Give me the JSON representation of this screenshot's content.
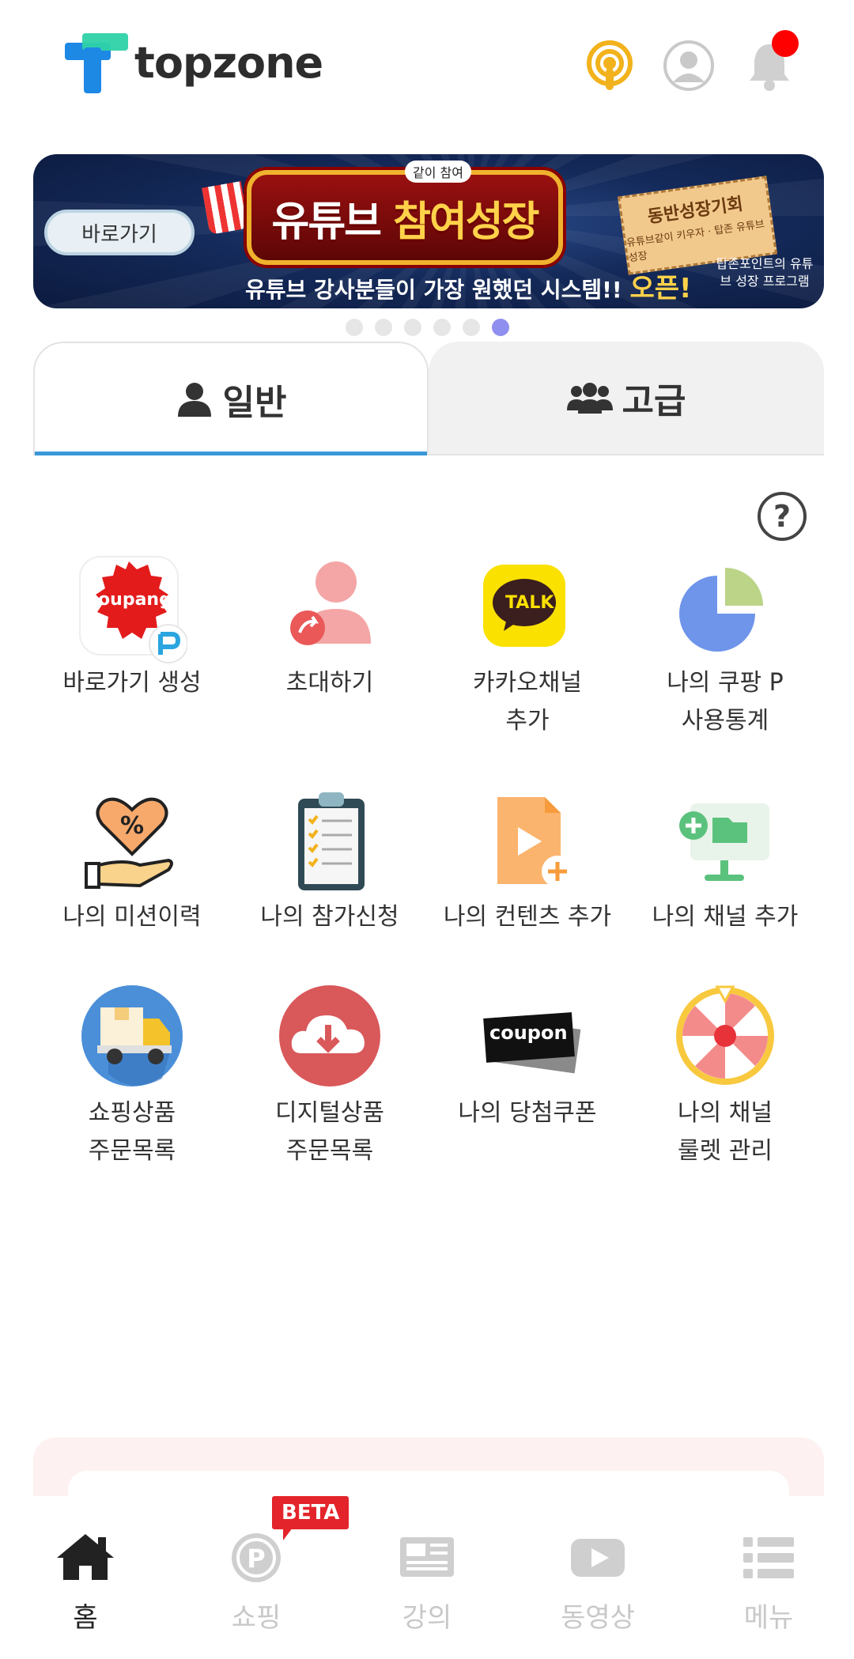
{
  "header": {
    "logo_text": "topzone"
  },
  "banner": {
    "button_label": "바로가기",
    "tag": "같이 참여",
    "title_a": "유튜브",
    "title_b": "참여성장",
    "subtitle": "유튜브 강사분들이 가장 원했던 시스템!!",
    "subtitle_hl": "오픈!",
    "ticket_title": "동반성장기회",
    "ticket_sub": "유튜브같이 키우자 · 탑존 유튜브 성장",
    "note": "탑존포인트의 유튜브 성장 프로그램",
    "dots_total": 6,
    "dots_active": 6
  },
  "tabs": {
    "basic": "일반",
    "advanced": "고급"
  },
  "help_icon": "?",
  "menu": [
    {
      "label": "바로가기 생성",
      "icon": "coupang-p-icon"
    },
    {
      "label": "초대하기",
      "icon": "invite-user-icon"
    },
    {
      "label": "카카오채널\n추가",
      "icon": "kakao-talk-icon"
    },
    {
      "label": "나의 쿠팡 P\n사용통계",
      "icon": "pie-chart-icon"
    },
    {
      "label": "나의 미션이력",
      "icon": "heart-hand-icon"
    },
    {
      "label": "나의 참가신청",
      "icon": "clipboard-icon"
    },
    {
      "label": "나의 컨텐츠 추가",
      "icon": "video-file-add-icon"
    },
    {
      "label": "나의 채널 추가",
      "icon": "channel-add-icon"
    },
    {
      "label": "쇼핑상품\n주문목록",
      "icon": "delivery-truck-icon"
    },
    {
      "label": "디지털상품\n주문목록",
      "icon": "cloud-download-icon"
    },
    {
      "label": "나의 당첨쿠폰",
      "icon": "coupon-icon"
    },
    {
      "label": "나의 채널\n룰렛 관리",
      "icon": "roulette-icon"
    }
  ],
  "coupang_text": "coupang",
  "talk_text": "TALK",
  "coupon_text": "coupon",
  "nav": {
    "home": "홈",
    "shopping": "쇼핑",
    "lecture": "강의",
    "video": "동영상",
    "menu": "메뉴",
    "beta": "BETA"
  },
  "colors": {
    "accent": "#3a97d8",
    "beta": "#e3242b",
    "podcast": "#f2b21b"
  }
}
